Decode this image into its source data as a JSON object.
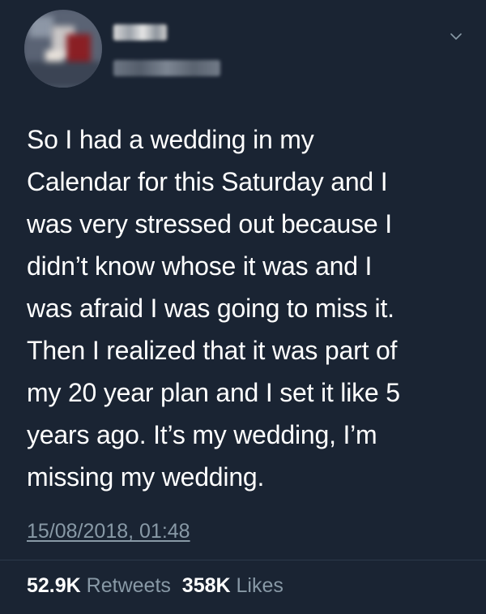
{
  "tweet": {
    "text": "So I had a wedding in my\nCalendar for this Saturday and I\nwas very stressed out because I\ndidn’t know whose it was and I\nwas afraid I was going to miss it.\nThen I realized that it was part of\nmy 20 year plan and I set it like 5\nyears ago. It’s my wedding, I’m\nmissing my wedding.",
    "timestamp": "15/08/2018, 01:48",
    "retweets_count": "52.9K",
    "retweets_label": "Retweets",
    "likes_count": "358K",
    "likes_label": "Likes"
  },
  "icons": {
    "more_menu": "chevron-down-icon",
    "avatar": "avatar"
  },
  "colors": {
    "background": "#1a2433",
    "text_primary": "#ffffff",
    "text_secondary": "#8899a6",
    "divider": "#2c3a4b"
  }
}
